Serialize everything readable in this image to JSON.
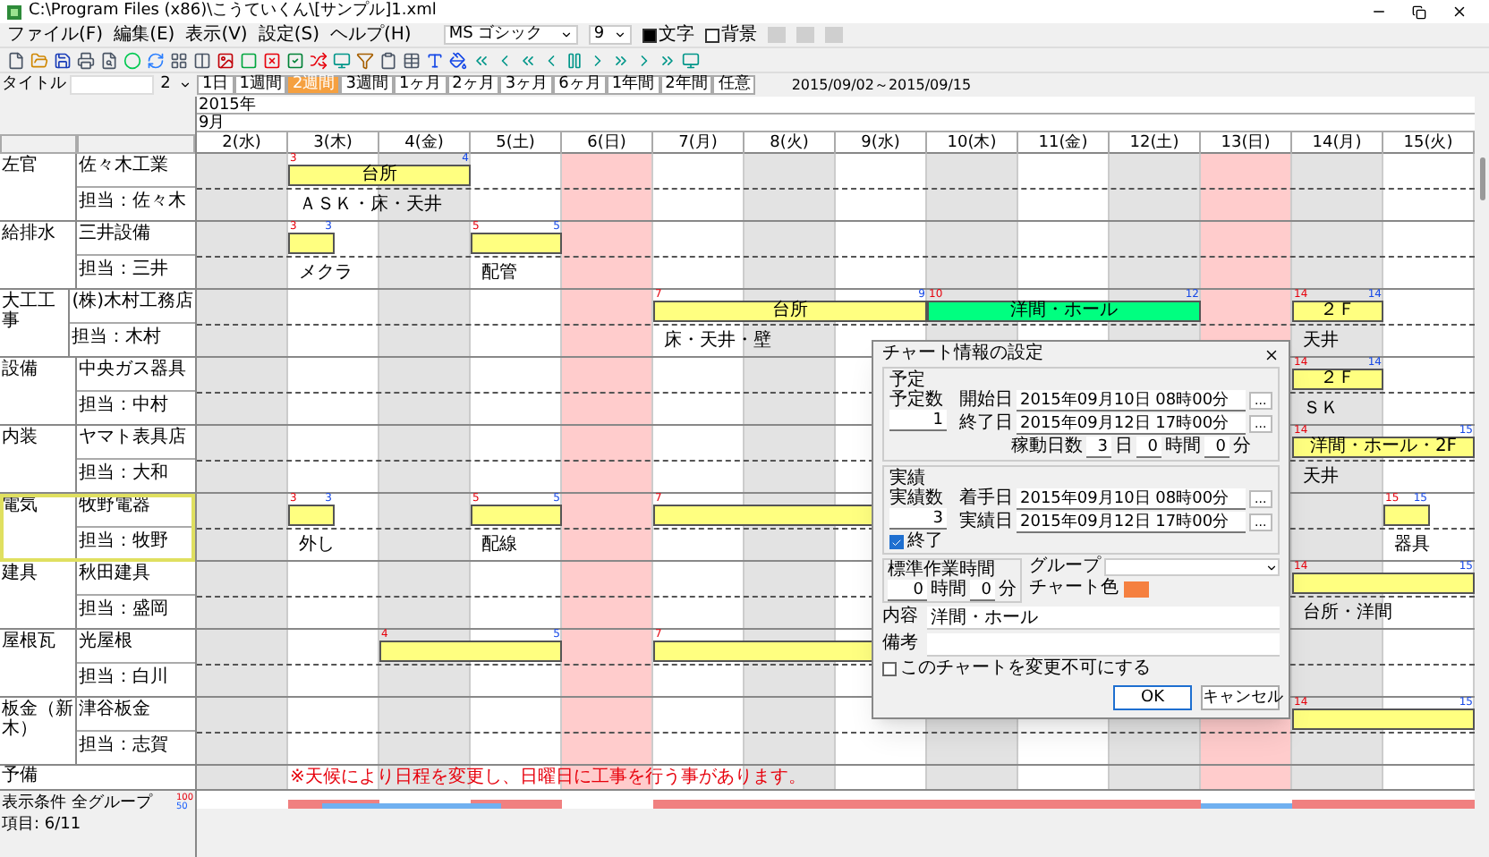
{
  "window": {
    "title": "C:\\Program Files (x86)\\こうていくん\\[サンプル]1.xml"
  },
  "menu": [
    "ファイル(F)",
    "編集(E)",
    "表示(V)",
    "設定(S)",
    "ヘルプ(H)"
  ],
  "font_combo": "MS ゴシック",
  "size_combo": "9",
  "text_color": {
    "label": "文字",
    "color": "#000000"
  },
  "background_color": {
    "label": "背景",
    "color": "#ffffff"
  },
  "title_field": {
    "label": "タイトル",
    "page_combo": "2"
  },
  "views": [
    {
      "label": "1日",
      "selected": false
    },
    {
      "label": "1週間",
      "selected": false
    },
    {
      "label": "2週間",
      "selected": true
    },
    {
      "label": "3週間",
      "selected": false
    },
    {
      "label": "1ヶ月",
      "selected": false
    },
    {
      "label": "2ヶ月",
      "selected": false
    },
    {
      "label": "3ヶ月",
      "selected": false
    },
    {
      "label": "6ヶ月",
      "selected": false
    },
    {
      "label": "1年間",
      "selected": false
    },
    {
      "label": "2年間",
      "selected": false
    },
    {
      "label": "任意",
      "selected": false
    }
  ],
  "range": "2015/09/02～2015/09/15",
  "year": "2015年",
  "month": "9月",
  "days": [
    {
      "label": "2(水)",
      "kind": "shaded"
    },
    {
      "label": "3(木)",
      "kind": "plain"
    },
    {
      "label": "4(金)",
      "kind": "shaded"
    },
    {
      "label": "5(土)",
      "kind": "plain"
    },
    {
      "label": "6(日)",
      "kind": "holiday"
    },
    {
      "label": "7(月)",
      "kind": "plain"
    },
    {
      "label": "8(火)",
      "kind": "shaded"
    },
    {
      "label": "9(水)",
      "kind": "plain"
    },
    {
      "label": "10(木)",
      "kind": "shaded"
    },
    {
      "label": "11(金)",
      "kind": "plain"
    },
    {
      "label": "12(土)",
      "kind": "shaded"
    },
    {
      "label": "13(日)",
      "kind": "holiday"
    },
    {
      "label": "14(月)",
      "kind": "shaded"
    },
    {
      "label": "15(火)",
      "kind": "plain"
    }
  ],
  "groups": [
    {
      "trade": "左官",
      "company": "佐々木工業",
      "staff": "担当：佐々木",
      "selected": false,
      "bars": [
        {
          "start": "3",
          "end": "4",
          "label": "台所",
          "note": "ＡＳＫ・床・天井",
          "color": "#ffff80"
        }
      ]
    },
    {
      "trade": "給排水",
      "company": "三井設備",
      "staff": "担当：三井",
      "selected": false,
      "bars": [
        {
          "start": "3",
          "end": "3",
          "half": true,
          "note": "メクラ",
          "color": "#ffff80"
        },
        {
          "start": "5",
          "end": "5",
          "note": "配管",
          "color": "#ffff80"
        }
      ]
    },
    {
      "trade": "大工工事",
      "company": "(株)木村工務店",
      "staff": "担当：木村",
      "selected": false,
      "bars": [
        {
          "start": "7",
          "end": "9",
          "label": "台所",
          "note": "床・天井・壁",
          "color": "#ffff80"
        },
        {
          "start": "10",
          "end": "12",
          "label": "洋間・ホール",
          "color": "#00ff80"
        },
        {
          "start": "14",
          "end": "14",
          "label": "２Ｆ",
          "note": "天井",
          "color": "#ffff80"
        }
      ]
    },
    {
      "trade": "設備",
      "company": "中央ガス器具",
      "staff": "担当：中村",
      "selected": false,
      "bars": [
        {
          "start": "14",
          "end": "14",
          "label": "２Ｆ",
          "note": "ＳＫ",
          "color": "#ffff80"
        }
      ]
    },
    {
      "trade": "内装",
      "company": "ヤマト表具店",
      "staff": "担当：大和",
      "selected": false,
      "bars": [
        {
          "start": "14",
          "end": "15",
          "label": "洋間・ホール・2F",
          "note": "天井",
          "color": "#ffff80"
        }
      ]
    },
    {
      "trade": "電気",
      "company": "牧野電器",
      "staff": "担当：牧野",
      "selected": true,
      "bars": [
        {
          "start": "3",
          "end": "3",
          "half": true,
          "note": "外し",
          "color": "#ffff80"
        },
        {
          "start": "5",
          "end": "5",
          "note": "配線",
          "color": "#ffff80"
        },
        {
          "start": "7",
          "color": "#ffff80"
        },
        {
          "start": "15",
          "end": "15",
          "half": true,
          "note": "器具",
          "color": "#ffff80"
        }
      ]
    },
    {
      "trade": "建具",
      "company": "秋田建具",
      "staff": "担当：盛岡",
      "selected": false,
      "bars": [
        {
          "start": "14",
          "end": "15",
          "note": "台所・洋間",
          "color": "#ffff80"
        }
      ]
    },
    {
      "trade": "屋根瓦",
      "company": "光屋根",
      "staff": "担当：白川",
      "selected": false,
      "bars": [
        {
          "start": "4",
          "end": "5",
          "color": "#ffff80"
        },
        {
          "start": "7",
          "color": "#ffff80"
        }
      ]
    },
    {
      "trade": "板金（新木）",
      "company": "津谷板金",
      "staff": "担当：志賀",
      "selected": false,
      "bars": [
        {
          "start": "14",
          "end": "15",
          "color": "#ffff80"
        }
      ]
    }
  ],
  "spare": {
    "trade": "予備",
    "note": "※天候により日程を変更し、日曜日に工事を行う事があります。"
  },
  "filter": "表示条件 全グループ",
  "scale": [
    "100",
    "50"
  ],
  "status": "項目: 6/11",
  "dialog": {
    "title": "チャート情報の設定",
    "plan": {
      "heading": "予定",
      "count_label": "予定数",
      "count_value": "1",
      "dates": [
        {
          "label": "開始日",
          "value": "2015年09月10日 08時00分",
          "picker": "..."
        },
        {
          "label": "終了日",
          "value": "2015年09月12日 17時00分",
          "picker": "..."
        }
      ],
      "days_label": "稼動日数",
      "days_value": "3",
      "days_unit": "日",
      "hours_value": "0",
      "hours_unit": "時間",
      "minutes_value": "0",
      "minutes_unit": "分"
    },
    "actual": {
      "heading": "実績",
      "count_label": "実績数",
      "count_value": "3",
      "done_label": "終了",
      "done_checked": true,
      "dates": [
        {
          "label": "着手日",
          "value": "2015年09月10日 08時00分",
          "picker": "..."
        },
        {
          "label": "実績日",
          "value": "2015年09月12日 17時00分",
          "picker": "..."
        }
      ]
    },
    "standard": {
      "label": "標準作業時間",
      "hours_value": "0",
      "hours_unit": "時間",
      "minutes_value": "0",
      "minutes_unit": "分"
    },
    "group_label": "グループ",
    "chart_color": {
      "label": "チャート色",
      "color": "#f58040"
    },
    "content_label": "内容",
    "content_value": "洋間・ホール",
    "note_label": "備考",
    "lock_label": "このチャートを変更不可にする",
    "lock_checked": false,
    "ok": "OK",
    "cancel": "キャンセル"
  }
}
